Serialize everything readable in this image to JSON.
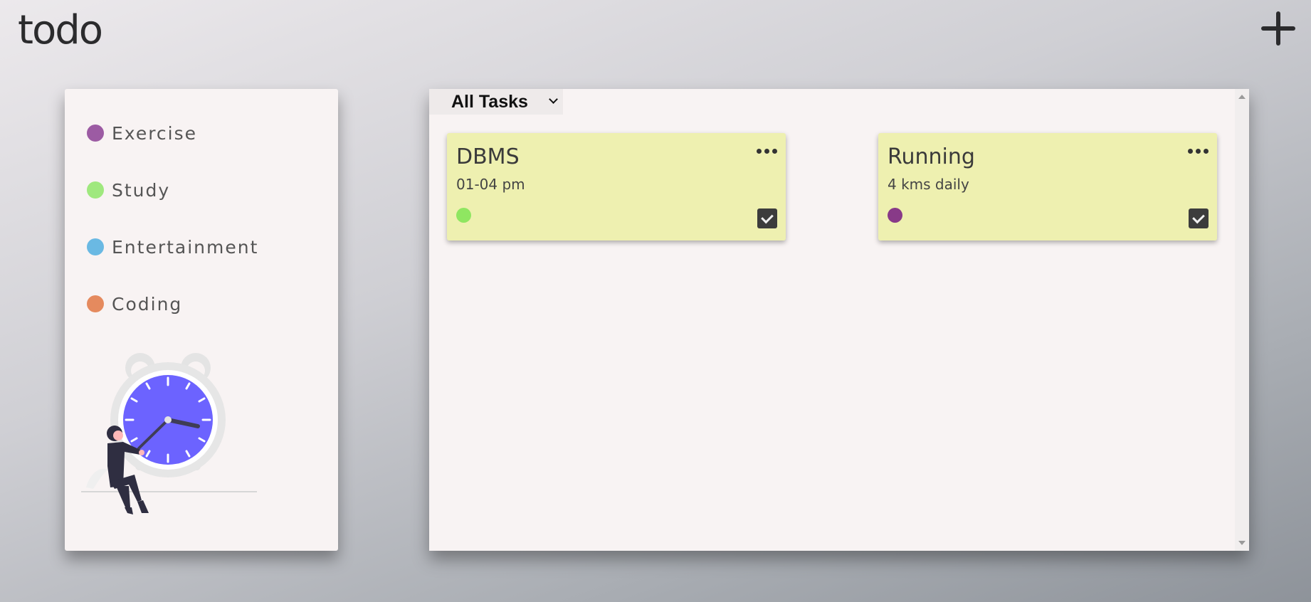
{
  "app": {
    "logo": "todo",
    "add_icon": "plus-icon"
  },
  "sidebar": {
    "categories": [
      {
        "label": "Exercise",
        "color": "#9c5ba3"
      },
      {
        "label": "Study",
        "color": "#9fe87e"
      },
      {
        "label": "Entertainment",
        "color": "#6ab9e3"
      },
      {
        "label": "Coding",
        "color": "#e58a5e"
      }
    ],
    "illustration": "clock-illustration"
  },
  "main": {
    "filter": {
      "selected": "All Tasks"
    },
    "tasks": [
      {
        "title": "DBMS",
        "description": "01-04 pm",
        "color": "#8fe661",
        "done": true
      },
      {
        "title": "Running",
        "description": "4 kms daily",
        "color": "#883a88",
        "done": true
      }
    ]
  }
}
